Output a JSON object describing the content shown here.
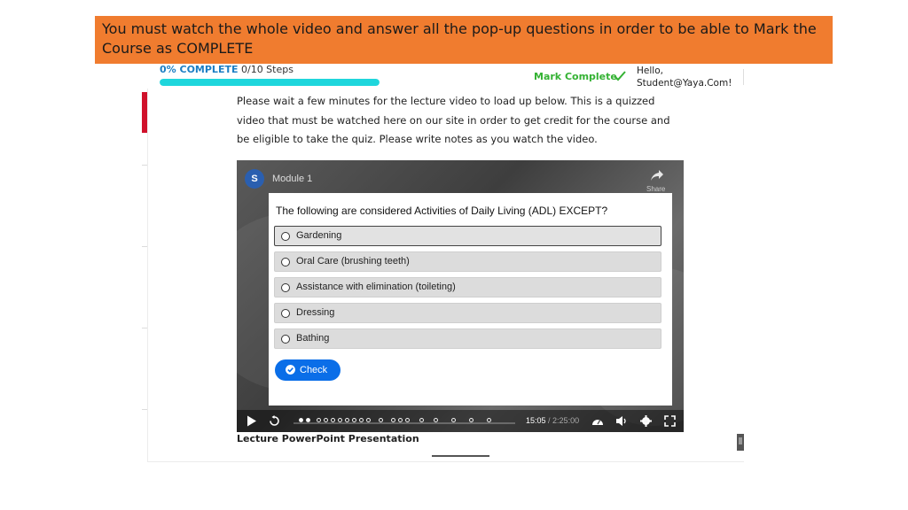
{
  "banner": {
    "text": "You must watch the whole video and answer all the pop-up questions in order to be able to Mark the Course as COMPLETE"
  },
  "progress": {
    "percent_label": "0% COMPLETE",
    "steps_label": "0/10 Steps",
    "fraction": 0.0
  },
  "header": {
    "mark_complete_label": "Mark Complete",
    "greeting": "Hello,",
    "user_email": "Student@Yaya.Com!"
  },
  "intro_text": "Please wait a few minutes for the lecture video to load up below. This is a quizzed video that must be watched here on our site in order to get credit for the course and be eligible to take the quiz. Please write notes as you watch the video.",
  "video": {
    "channel_initial": "S",
    "title": "Module 1",
    "share_label": "Share",
    "current_time": "15:05",
    "separator": " / ",
    "total_time": "2:25:00"
  },
  "quiz": {
    "question": "The following are considered Activities of Daily Living (ADL) EXCEPT?",
    "options": [
      {
        "label": "Gardening",
        "selected": true
      },
      {
        "label": "Oral Care (brushing teeth)",
        "selected": false
      },
      {
        "label": "Assistance with elimination (toileting)",
        "selected": false
      },
      {
        "label": "Dressing",
        "selected": false
      },
      {
        "label": "Bathing",
        "selected": false
      }
    ],
    "check_label": "Check"
  },
  "lecture_link": "Lecture PowerPoint Presentation",
  "colors": {
    "banner": "#f07c2f",
    "progress_fill": "#1fd6dc",
    "mark_complete": "#34b233",
    "check_button": "#0a6ee8",
    "accent_red": "#d0112b"
  },
  "icons": [
    "check-icon",
    "share-icon",
    "play-icon",
    "replay-icon",
    "settings-icon",
    "volume-icon",
    "gear-icon",
    "fullscreen-icon"
  ]
}
